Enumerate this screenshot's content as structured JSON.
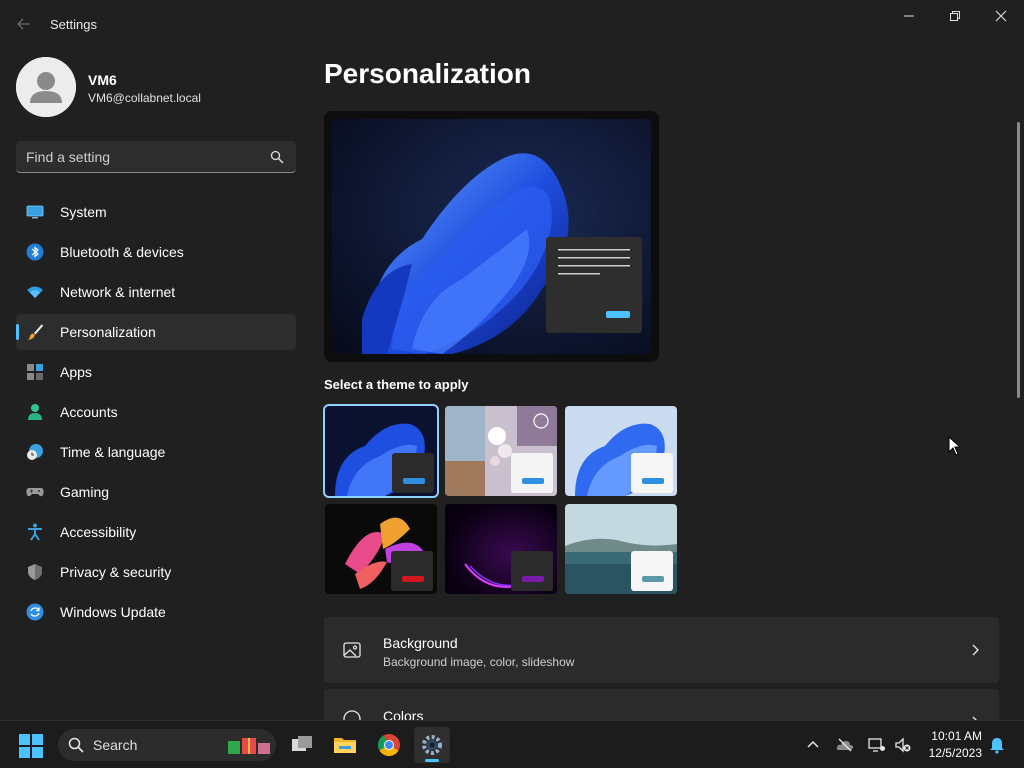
{
  "window": {
    "app_title": "Settings"
  },
  "profile": {
    "name": "VM6",
    "email": "VM6@collabnet.local"
  },
  "search": {
    "placeholder": "Find a setting"
  },
  "sidebar": {
    "items": [
      {
        "label": "System",
        "icon": "system-icon"
      },
      {
        "label": "Bluetooth & devices",
        "icon": "bluetooth-icon"
      },
      {
        "label": "Network & internet",
        "icon": "wifi-icon"
      },
      {
        "label": "Personalization",
        "icon": "brush-icon",
        "active": true
      },
      {
        "label": "Apps",
        "icon": "apps-icon"
      },
      {
        "label": "Accounts",
        "icon": "accounts-icon"
      },
      {
        "label": "Time & language",
        "icon": "clock-globe-icon"
      },
      {
        "label": "Gaming",
        "icon": "gamepad-icon"
      },
      {
        "label": "Accessibility",
        "icon": "accessibility-icon"
      },
      {
        "label": "Privacy & security",
        "icon": "shield-icon"
      },
      {
        "label": "Windows Update",
        "icon": "update-icon"
      }
    ]
  },
  "main": {
    "title": "Personalization",
    "themes_label": "Select a theme to apply",
    "themes": [
      {
        "name": "windows-dark",
        "selected": true
      },
      {
        "name": "windows-spotlight"
      },
      {
        "name": "windows-light"
      },
      {
        "name": "glow"
      },
      {
        "name": "captured-motion"
      },
      {
        "name": "flow"
      }
    ],
    "cards": [
      {
        "title": "Background",
        "subtitle": "Background image, color, slideshow",
        "icon": "image-icon"
      },
      {
        "title": "Colors",
        "subtitle": "",
        "icon": "palette-icon"
      }
    ]
  },
  "taskbar": {
    "search_label": "Search",
    "time": "10:01 AM",
    "date": "12/5/2023"
  },
  "colors": {
    "accent": "#4cc2ff",
    "background": "#202020",
    "card": "#2b2b2b"
  }
}
